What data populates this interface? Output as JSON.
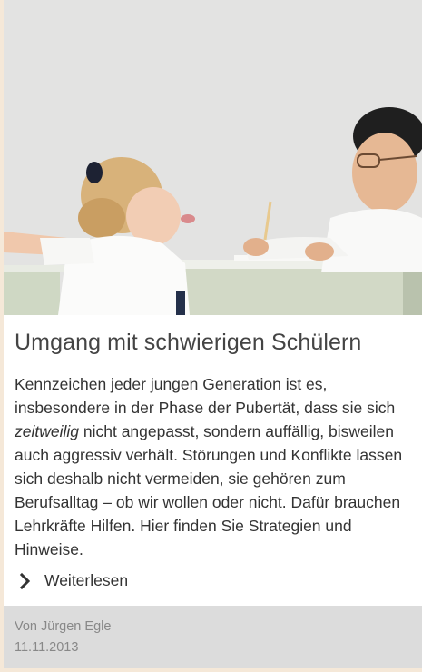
{
  "article": {
    "image_alt": "",
    "title": "Umgang mit schwierigen Schülern",
    "teaser": {
      "part1": "Kennzeichen jeder jungen Generation ist es, insbesondere in der Phase der Pubertät, dass sie sich ",
      "emphasis": "zeitweilig",
      "part2": " nicht angepasst, sondern auffällig, bisweilen auch aggressiv verhält. Störungen und Konflikte lassen sich deshalb nicht vermeiden, sie gehören zum Berufsalltag – ob wir wollen oder nicht. Dafür brauchen Lehrkräfte Hilfen. Hier finden Sie Strategien und Hinweise."
    },
    "read_more_label": "Weiterlesen",
    "read_more_icon": "chevron-right-icon",
    "author": "Von Jürgen Egle",
    "date": "11.11.2013"
  },
  "colors": {
    "page_background": "#f5e8d8",
    "card_background": "#ffffff",
    "meta_background": "#dcdcdc",
    "title_color": "#444444",
    "text_color": "#333333",
    "meta_text_color": "#888888"
  }
}
